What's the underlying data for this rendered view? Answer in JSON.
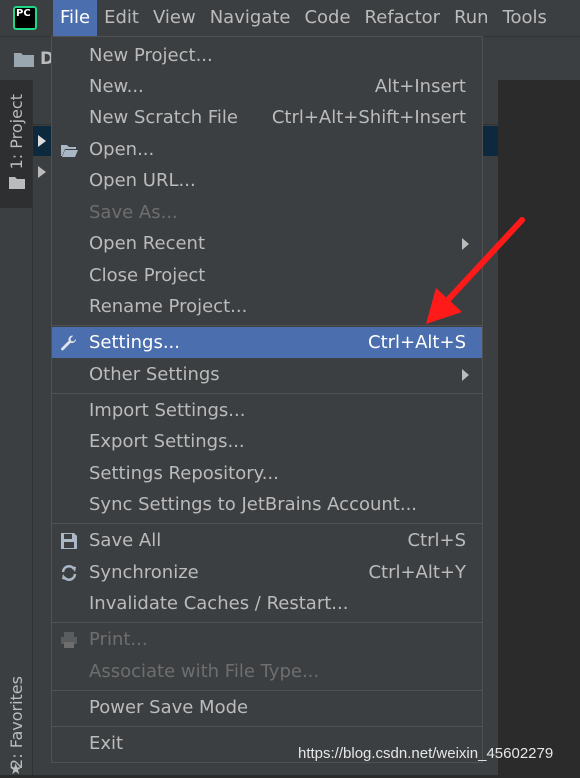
{
  "app": {
    "logo_text": "PC"
  },
  "menubar": {
    "items": [
      {
        "label": "File",
        "active": true
      },
      {
        "label": "Edit"
      },
      {
        "label": "View"
      },
      {
        "label": "Navigate"
      },
      {
        "label": "Code"
      },
      {
        "label": "Refactor"
      },
      {
        "label": "Run"
      },
      {
        "label": "Tools"
      }
    ]
  },
  "toolbar": {
    "crumb": "D"
  },
  "left_strip": {
    "project_tab": "1: Project",
    "favorites_tab": "2: Favorites"
  },
  "file_menu": {
    "items": [
      {
        "label": "New Project...",
        "shortcut": ""
      },
      {
        "label": "New...",
        "shortcut": "Alt+Insert"
      },
      {
        "label": "New Scratch File",
        "shortcut": "Ctrl+Alt+Shift+Insert"
      },
      {
        "label": "Open...",
        "shortcut": "",
        "icon": "folder-open-icon"
      },
      {
        "label": "Open URL...",
        "shortcut": ""
      },
      {
        "label": "Save As...",
        "shortcut": "",
        "disabled": true
      },
      {
        "label": "Open Recent",
        "shortcut": "",
        "submenu": true
      },
      {
        "label": "Close Project",
        "shortcut": ""
      },
      {
        "label": "Rename Project...",
        "shortcut": ""
      },
      {
        "label": "Settings...",
        "shortcut": "Ctrl+Alt+S",
        "icon": "wrench-icon",
        "selected": true
      },
      {
        "label": "Other Settings",
        "shortcut": "",
        "submenu": true
      },
      {
        "label": "Import Settings...",
        "shortcut": ""
      },
      {
        "label": "Export Settings...",
        "shortcut": ""
      },
      {
        "label": "Settings Repository...",
        "shortcut": ""
      },
      {
        "label": "Sync Settings to JetBrains Account...",
        "shortcut": ""
      },
      {
        "label": "Save All",
        "shortcut": "Ctrl+S",
        "icon": "save-icon"
      },
      {
        "label": "Synchronize",
        "shortcut": "Ctrl+Alt+Y",
        "icon": "sync-icon"
      },
      {
        "label": "Invalidate Caches / Restart...",
        "shortcut": ""
      },
      {
        "label": "Print...",
        "shortcut": "",
        "disabled": true,
        "icon": "printer-icon"
      },
      {
        "label": "Associate with File Type...",
        "shortcut": "",
        "disabled": true
      },
      {
        "label": "Power Save Mode",
        "shortcut": ""
      },
      {
        "label": "Exit",
        "shortcut": ""
      }
    ]
  },
  "watermark": "https://blog.csdn.net/weixin_45602279",
  "colors": {
    "menu_bg": "#3c3f41",
    "selection": "#4b6eaf",
    "text": "#bbbbbb",
    "disabled_text": "#6e6e6e",
    "annotation": "#ff1a1a"
  }
}
